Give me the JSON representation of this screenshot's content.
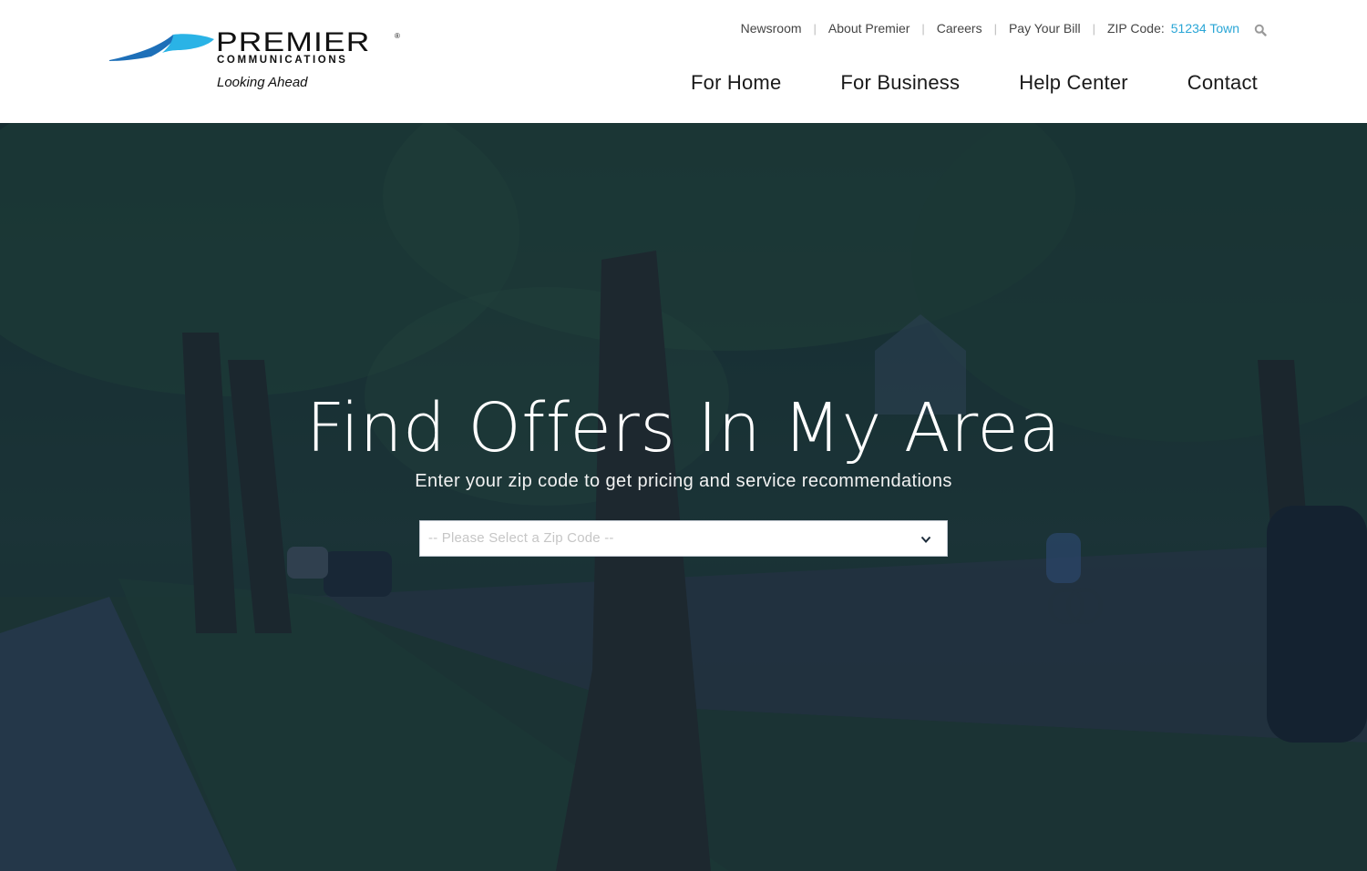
{
  "brand": {
    "name": "PREMIER",
    "registered": "®",
    "subtitle": "COMMUNICATIONS",
    "tagline": "Looking Ahead",
    "colors": {
      "swoosh_dark": "#1d6fb8",
      "swoosh_light": "#2ab3e6",
      "zip_accent": "#2aa6d6"
    }
  },
  "utility_nav": {
    "items": [
      "Newsroom",
      "About Premier",
      "Careers",
      "Pay Your Bill"
    ],
    "zip_label": "ZIP Code:",
    "zip_value": "51234 Town",
    "search_icon": "search-icon"
  },
  "main_nav": {
    "items": [
      "For Home",
      "For Business",
      "Help Center",
      "Contact"
    ]
  },
  "hero": {
    "title": "Find Offers In My Area",
    "subtitle": "Enter your zip code to get pricing and service recommendations",
    "zip_select": {
      "placeholder": "-- Please Select a Zip Code --",
      "icon": "chevron-down-icon"
    }
  }
}
